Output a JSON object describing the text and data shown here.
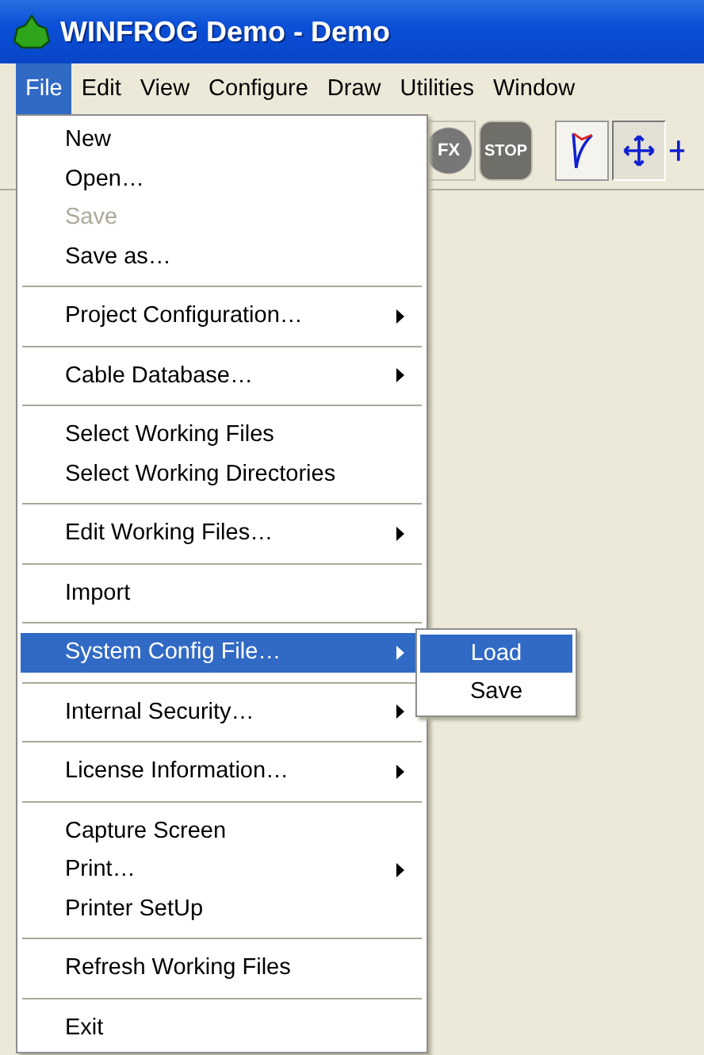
{
  "window": {
    "title": "WINFROG Demo - Demo"
  },
  "menubar": [
    {
      "label": "File",
      "selected": true
    },
    {
      "label": "Edit",
      "selected": false
    },
    {
      "label": "View",
      "selected": false
    },
    {
      "label": "Configure",
      "selected": false
    },
    {
      "label": "Draw",
      "selected": false
    },
    {
      "label": "Utilities",
      "selected": false
    },
    {
      "label": "Window",
      "selected": false
    }
  ],
  "toolbar": [
    {
      "kind": "fx",
      "label": "FX",
      "disabled": true
    },
    {
      "kind": "stop",
      "label": "STOP",
      "disabled": true
    },
    {
      "kind": "curve",
      "disabled": false
    },
    {
      "kind": "move",
      "disabled": false
    }
  ],
  "file_menu": [
    {
      "kind": "item",
      "label": "New",
      "disabled": false,
      "submenu": false,
      "selected": false
    },
    {
      "kind": "item",
      "label": "Open…",
      "disabled": false,
      "submenu": false,
      "selected": false
    },
    {
      "kind": "item",
      "label": "Save",
      "disabled": true,
      "submenu": false,
      "selected": false
    },
    {
      "kind": "item",
      "label": "Save as…",
      "disabled": false,
      "submenu": false,
      "selected": false
    },
    {
      "kind": "separator"
    },
    {
      "kind": "item",
      "label": "Project Configuration…",
      "disabled": false,
      "submenu": true,
      "selected": false
    },
    {
      "kind": "separator"
    },
    {
      "kind": "item",
      "label": "Cable Database…",
      "disabled": false,
      "submenu": true,
      "selected": false
    },
    {
      "kind": "separator"
    },
    {
      "kind": "item",
      "label": "Select Working Files",
      "disabled": false,
      "submenu": false,
      "selected": false
    },
    {
      "kind": "item",
      "label": "Select Working Directories",
      "disabled": false,
      "submenu": false,
      "selected": false
    },
    {
      "kind": "separator"
    },
    {
      "kind": "item",
      "label": "Edit Working Files…",
      "disabled": false,
      "submenu": true,
      "selected": false
    },
    {
      "kind": "separator"
    },
    {
      "kind": "item",
      "label": "Import",
      "disabled": false,
      "submenu": false,
      "selected": false
    },
    {
      "kind": "separator"
    },
    {
      "kind": "item",
      "label": "System Config File…",
      "disabled": false,
      "submenu": true,
      "selected": true
    },
    {
      "kind": "separator"
    },
    {
      "kind": "item",
      "label": "Internal Security…",
      "disabled": false,
      "submenu": true,
      "selected": false
    },
    {
      "kind": "separator"
    },
    {
      "kind": "item",
      "label": "License Information…",
      "disabled": false,
      "submenu": true,
      "selected": false
    },
    {
      "kind": "separator"
    },
    {
      "kind": "item",
      "label": "Capture Screen",
      "disabled": false,
      "submenu": false,
      "selected": false
    },
    {
      "kind": "item",
      "label": "Print…",
      "disabled": false,
      "submenu": true,
      "selected": false
    },
    {
      "kind": "item",
      "label": "Printer SetUp",
      "disabled": false,
      "submenu": false,
      "selected": false
    },
    {
      "kind": "separator"
    },
    {
      "kind": "item",
      "label": "Refresh Working Files",
      "disabled": false,
      "submenu": false,
      "selected": false
    },
    {
      "kind": "separator"
    },
    {
      "kind": "item",
      "label": "Exit",
      "disabled": false,
      "submenu": false,
      "selected": false
    }
  ],
  "submenu": [
    {
      "label": "Load",
      "selected": true
    },
    {
      "label": "Save",
      "selected": false
    }
  ]
}
